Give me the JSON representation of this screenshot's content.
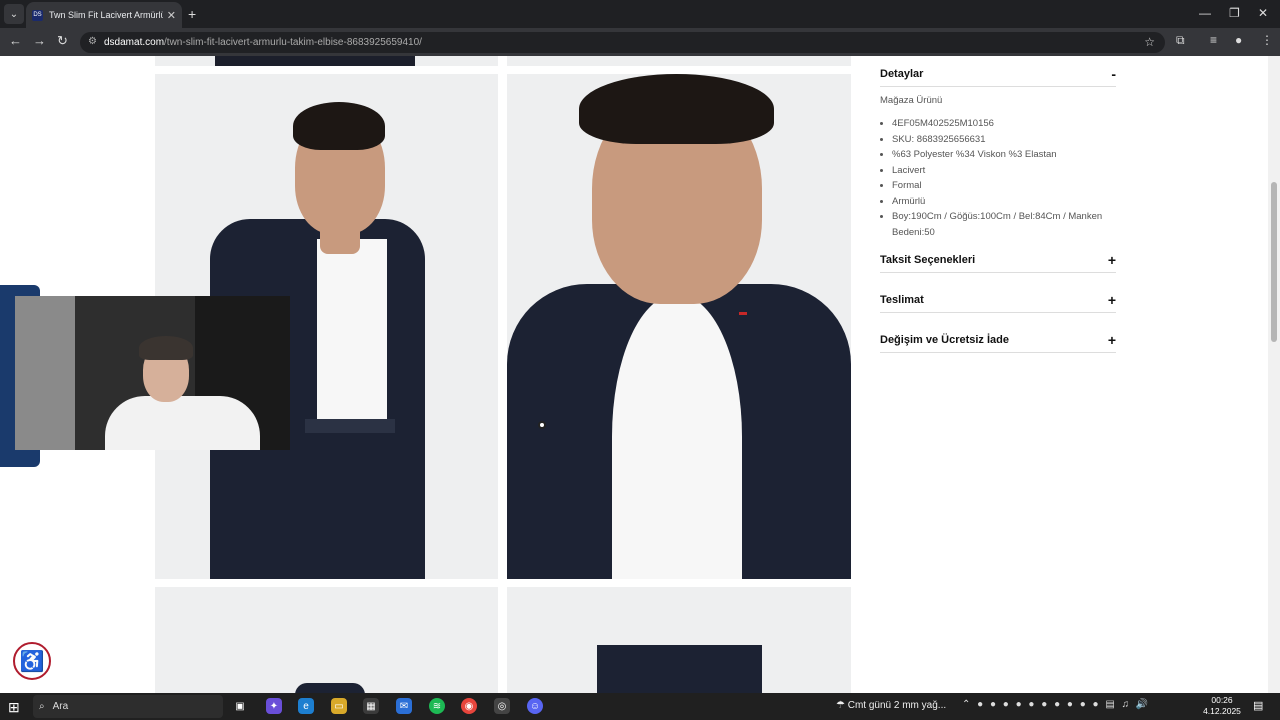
{
  "browser": {
    "tab_title": "Twn Slim Fit Lacivert Armürlü Ta",
    "tab_favicon_text": "DS",
    "url_host": "dsdamat.com",
    "url_path": "/twn-slim-fit-lacivert-armurlu-takim-elbise-8683925659410/"
  },
  "details": {
    "title": "Detaylar",
    "toggle": "-",
    "store": "Mağaza Ürünü",
    "specs": [
      "4EF05M402525M10156",
      "SKU: 8683925656631",
      "%63 Polyester %34 Viskon %3 Elastan",
      "Lacivert",
      "Formal",
      "Armürlü",
      "Boy:190Cm / Göğüs:100Cm / Bel:84Cm / Manken Bedeni:50"
    ]
  },
  "accordions": [
    {
      "label": "Taksit Seçenekleri",
      "toggle": "+"
    },
    {
      "label": "Teslimat",
      "toggle": "+"
    },
    {
      "label": "Değişim ve Ücretsiz İade",
      "toggle": "+"
    }
  ],
  "taskbar": {
    "search_placeholder": "Ara",
    "weather": "Cmt günü 2 mm yağ...",
    "time": "00:26",
    "date": "4.12.2025"
  },
  "colors": {
    "accent": "#b01c2e",
    "suit": "#1c2233"
  },
  "icons": {
    "accessibility": "accessibility-icon",
    "start": "windows-start-icon",
    "search": "search-icon"
  }
}
